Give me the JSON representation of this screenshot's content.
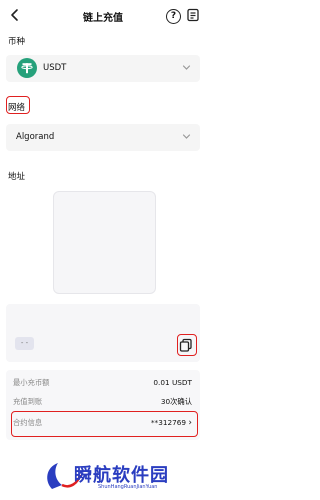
{
  "header": {
    "title": "链上充值",
    "back_icon": "back-arrow-icon",
    "help_icon": "help-icon",
    "history_icon": "history-icon",
    "help_glyph": "?"
  },
  "currency": {
    "label": "币种",
    "value": "USDT",
    "icon": "usdt-logo-icon"
  },
  "network": {
    "label": "网络",
    "value": "Algorand"
  },
  "address": {
    "label": "地址",
    "chip": "- -"
  },
  "info": {
    "rows": [
      {
        "label": "最小充币额",
        "value": "0.01 USDT"
      },
      {
        "label": "充值到账",
        "value": "30次确认"
      },
      {
        "label": "合约信息",
        "value": "**312769"
      }
    ]
  },
  "watermark": {
    "text": "瞬航软件园",
    "subtext": "ShunHangRuanJianYuan"
  },
  "colors": {
    "highlight": "#e02020",
    "usdt_green": "#26a17b",
    "watermark_blue": "#2a3dc0"
  }
}
